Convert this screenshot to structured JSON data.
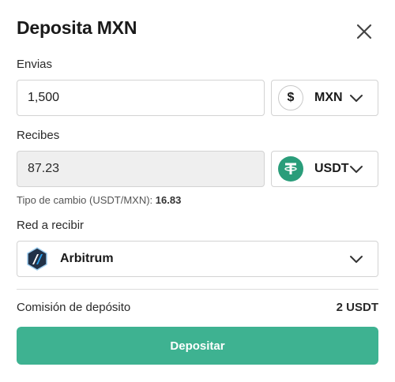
{
  "header": {
    "title": "Deposita MXN"
  },
  "send": {
    "label": "Envias",
    "amount": "1,500",
    "currency": {
      "code": "MXN",
      "icon": "peso-icon",
      "symbol": "$"
    }
  },
  "receive": {
    "label": "Recibes",
    "amount": "87.23",
    "currency": {
      "code": "USDT",
      "icon": "tether-icon",
      "symbol": "₮"
    }
  },
  "rate": {
    "label": "Tipo de cambio (USDT/MXN):",
    "value": "16.83"
  },
  "network": {
    "label": "Red a recibir",
    "selected": "Arbitrum",
    "icon": "arbitrum-icon"
  },
  "fee": {
    "label": "Comisión de depósito",
    "value": "2 USDT"
  },
  "action": {
    "label": "Depositar"
  },
  "colors": {
    "accent": "#3eb291",
    "tether": "#2a9d7a"
  }
}
